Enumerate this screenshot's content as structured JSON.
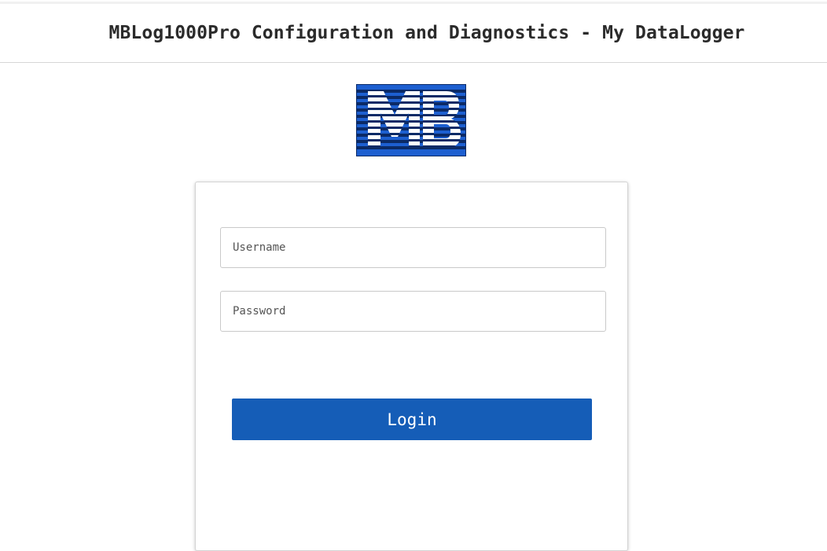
{
  "header": {
    "title": "MBLog1000Pro Configuration and Diagnostics - My DataLogger"
  },
  "logo": {
    "text": "MB",
    "colors": {
      "background": "#1d5fd0",
      "dark": "#0b2a66",
      "letters": "#ffffff"
    }
  },
  "login_form": {
    "username": {
      "placeholder": "Username",
      "value": ""
    },
    "password": {
      "placeholder": "Password",
      "value": ""
    },
    "login_label": "Login"
  },
  "colors": {
    "accent": "#155db7",
    "title_text": "#2b2b2b",
    "border": "#c9c9c9"
  }
}
